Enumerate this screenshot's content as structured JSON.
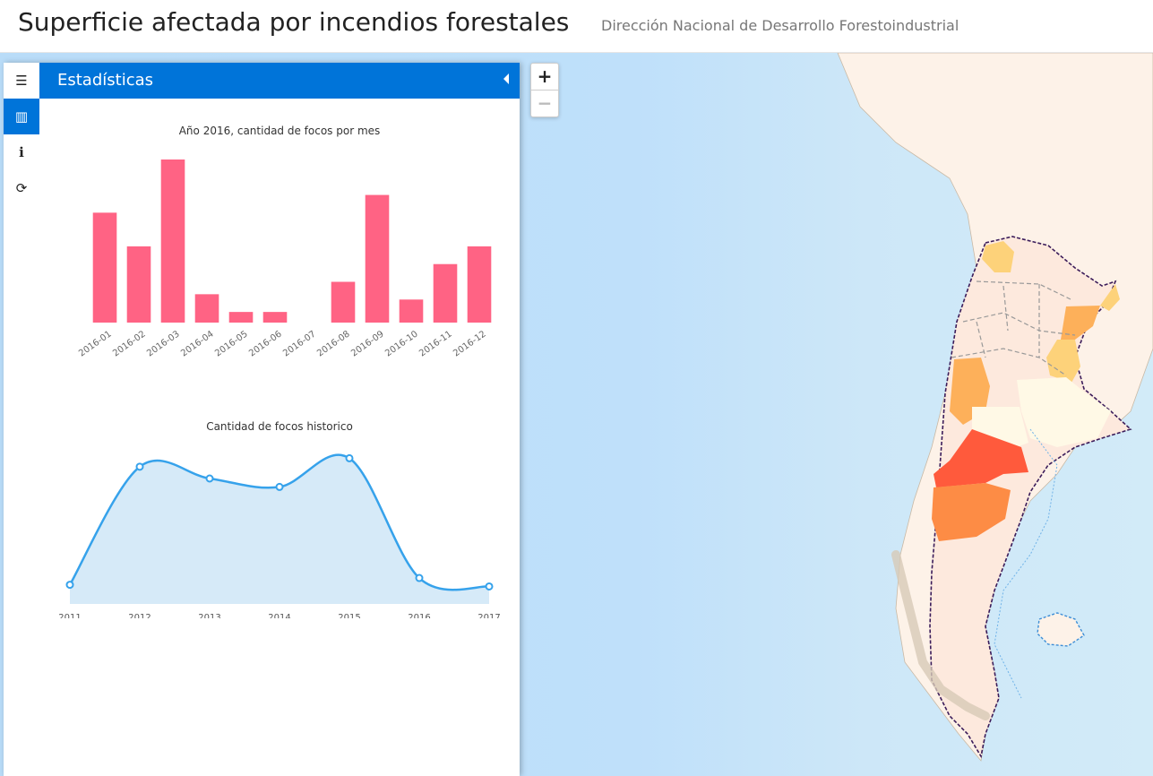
{
  "header": {
    "title": "Superficie afectada por incendios forestales",
    "subtitle": "Dirección Nacional de Desarrollo Forestoindustrial"
  },
  "sidebar": {
    "tabs": [
      {
        "icon": "menu-icon",
        "glyph": "☰"
      },
      {
        "icon": "bar-chart-icon",
        "glyph": "▥"
      },
      {
        "icon": "info-icon",
        "glyph": "ℹ"
      },
      {
        "icon": "refresh-icon",
        "glyph": "⟳"
      }
    ],
    "pane_title": "Estadísticas"
  },
  "map": {
    "zoom_in": "+",
    "zoom_out": "−"
  },
  "chart_data": [
    {
      "type": "bar",
      "title": "Año 2016, cantidad de focos por mes",
      "categories": [
        "2016-01",
        "2016-02",
        "2016-03",
        "2016-04",
        "2016-05",
        "2016-06",
        "2016-07",
        "2016-08",
        "2016-09",
        "2016-10",
        "2016-11",
        "2016-12"
      ],
      "values": [
        62,
        43,
        92,
        16,
        6,
        6,
        0,
        23,
        72,
        13,
        33,
        43
      ],
      "color": "#ff6384"
    },
    {
      "type": "area",
      "title": "Cantidad de focos historico",
      "categories": [
        "2011",
        "2012",
        "2013",
        "2014",
        "2015",
        "2016",
        "2017"
      ],
      "values": [
        5,
        75,
        68,
        63,
        80,
        9,
        4
      ],
      "color": "#36a2eb"
    }
  ]
}
